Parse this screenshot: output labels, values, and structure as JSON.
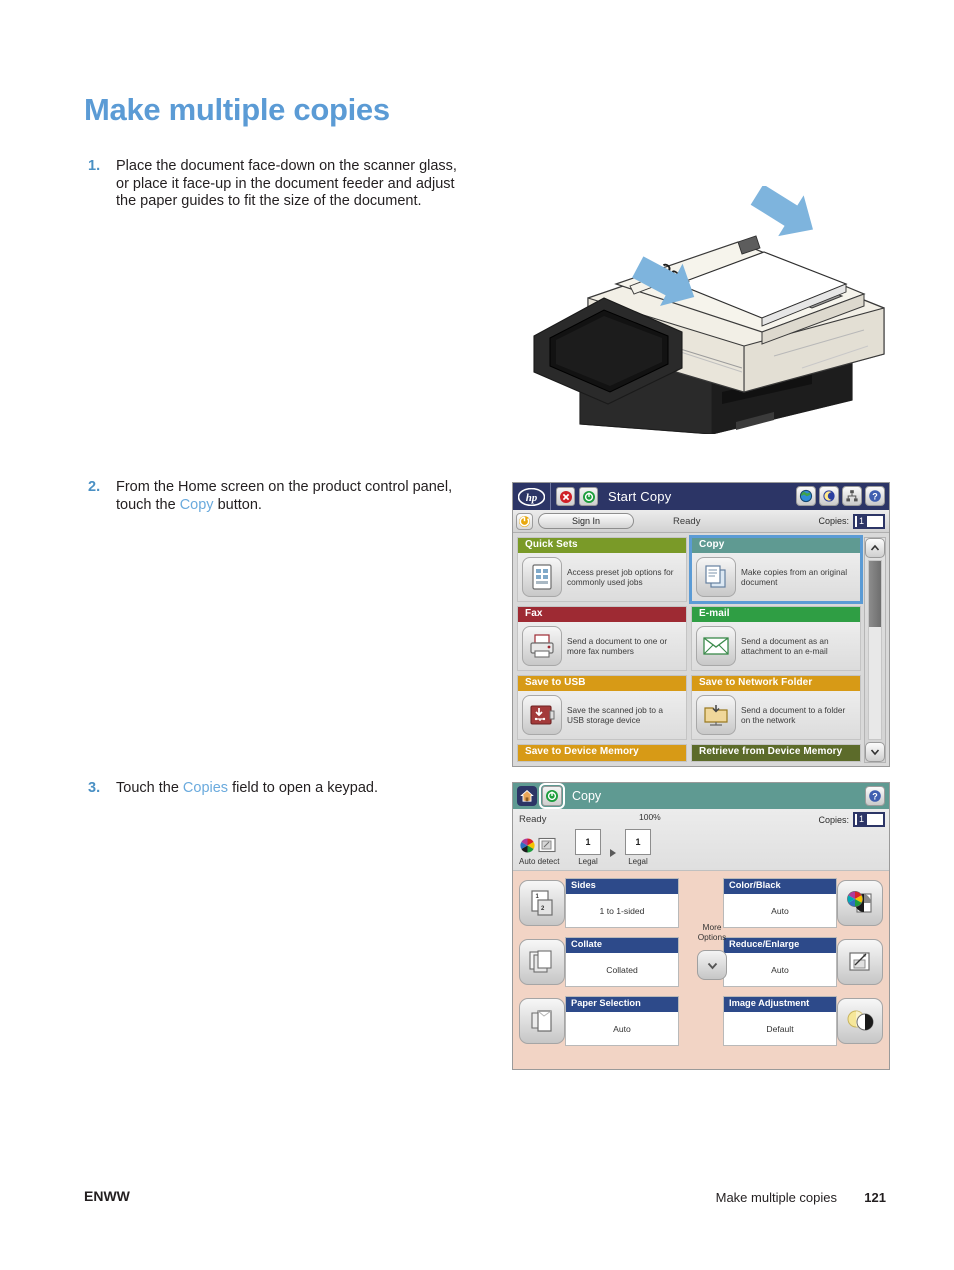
{
  "page": {
    "title": "Make multiple copies",
    "footer_left": "ENWW",
    "footer_center": "Make multiple copies",
    "footer_page": "121"
  },
  "steps": [
    {
      "number": "1.",
      "text_parts": [
        "Place the document face-down on the scanner glass, or place it face-up in the document feeder and adjust the paper guides to fit the size of the document."
      ]
    },
    {
      "number": "2.",
      "before": "From the Home screen on the product control panel, touch the ",
      "link": "Copy",
      "after": " button."
    },
    {
      "number": "3.",
      "before": "Touch the ",
      "link": "Copies",
      "after": " field to open a keypad."
    }
  ],
  "home_panel": {
    "brand": "hp",
    "header_title": "Start Copy",
    "sign_in": "Sign In",
    "status": "Ready",
    "copies_label": "Copies:",
    "copies_value": "1",
    "icons": {
      "stop": "stop-icon",
      "start": "start-icon",
      "globe": "globe-icon",
      "sleep": "moon-icon",
      "network": "network-icon",
      "help": "help-icon",
      "power": "power-icon",
      "scroll_up": "chevron-up-icon",
      "scroll_down": "chevron-down-icon"
    },
    "tiles": [
      {
        "label": "Quick Sets",
        "desc": "Access preset job options for commonly used jobs",
        "color": "#7a9a28",
        "icon": "quick-sets-icon",
        "selected": false
      },
      {
        "label": "Copy",
        "desc": "Make copies from an original document",
        "color": "#5f9a92",
        "icon": "copy-icon",
        "selected": true
      },
      {
        "label": "Fax",
        "desc": "Send a document to one or more fax numbers",
        "color": "#9e2a33",
        "icon": "fax-icon",
        "selected": false
      },
      {
        "label": "E-mail",
        "desc": "Send a document as an attachment to an e-mail",
        "color": "#2f9e44",
        "icon": "email-icon",
        "selected": false
      },
      {
        "label": "Save to USB",
        "desc": "Save the scanned job to a USB storage device",
        "color": "#d79a16",
        "icon": "usb-icon",
        "selected": false
      },
      {
        "label": "Save to Network Folder",
        "desc": "Send a document to a folder on the network",
        "color": "#d79a16",
        "icon": "network-folder-icon",
        "selected": false
      }
    ],
    "tiles_partial": [
      {
        "label": "Save to Device Memory",
        "color": "#d79a16"
      },
      {
        "label": "Retrieve from Device Memory",
        "color": "#5c6b2a"
      }
    ]
  },
  "copy_panel": {
    "header_title": "Copy",
    "status": "Ready",
    "copies_label": "Copies:",
    "copies_value": "1",
    "scale": "100%",
    "auto_detect": "Auto detect",
    "source_page_count": "1",
    "source_size": "Legal",
    "dest_page_count": "1",
    "dest_size": "Legal",
    "more_options": "More\nOptions",
    "more_options_line1": "More",
    "more_options_line2": "Options",
    "options": [
      {
        "label": "Sides",
        "value": "1 to 1-sided",
        "icon": "sides-icon"
      },
      {
        "label": "Collate",
        "value": "Collated",
        "icon": "collate-icon"
      },
      {
        "label": "Paper Selection",
        "value": "Auto",
        "icon": "paper-selection-icon"
      },
      {
        "label": "Color/Black",
        "value": "Auto",
        "icon": "color-black-icon"
      },
      {
        "label": "Reduce/Enlarge",
        "value": "Auto",
        "icon": "reduce-enlarge-icon"
      },
      {
        "label": "Image Adjustment",
        "value": "Default",
        "icon": "image-adjustment-icon"
      }
    ]
  },
  "illustration": {
    "name": "mfp-document-feeder-illustration",
    "page_text": "ABC"
  },
  "colors": {
    "heading": "#5b9bd5",
    "link": "#6aaadd",
    "header_navy": "#2c3566",
    "copy_teal": "#5f9a92",
    "option_blue": "#2d4a8a",
    "copy_bg": "#f2d4c5"
  }
}
